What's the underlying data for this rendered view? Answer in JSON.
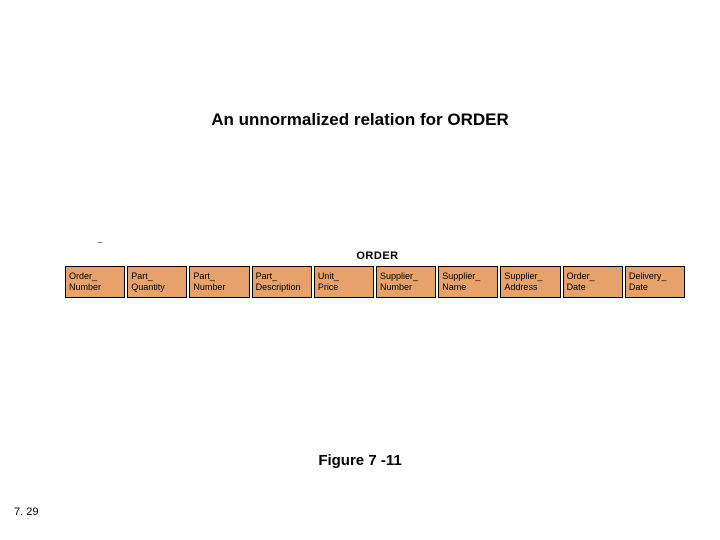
{
  "title": "An unnormalized relation for ORDER",
  "tilde": "~",
  "table": {
    "caption": "ORDER",
    "columns": [
      {
        "l1": "Order_",
        "l2": "Number"
      },
      {
        "l1": "Part_",
        "l2": "Quantity"
      },
      {
        "l1": "Part_",
        "l2": "Number"
      },
      {
        "l1": "Part_",
        "l2": "Description"
      },
      {
        "l1": "Unit_",
        "l2": "Price"
      },
      {
        "l1": "Supplier_",
        "l2": "Number"
      },
      {
        "l1": "Supplier_",
        "l2": "Name"
      },
      {
        "l1": "Supplier_",
        "l2": "Address"
      },
      {
        "l1": "Order_",
        "l2": "Date"
      },
      {
        "l1": "Delivery_",
        "l2": "Date"
      }
    ]
  },
  "figure_label": "Figure 7 -11",
  "page_number": "7. 29"
}
